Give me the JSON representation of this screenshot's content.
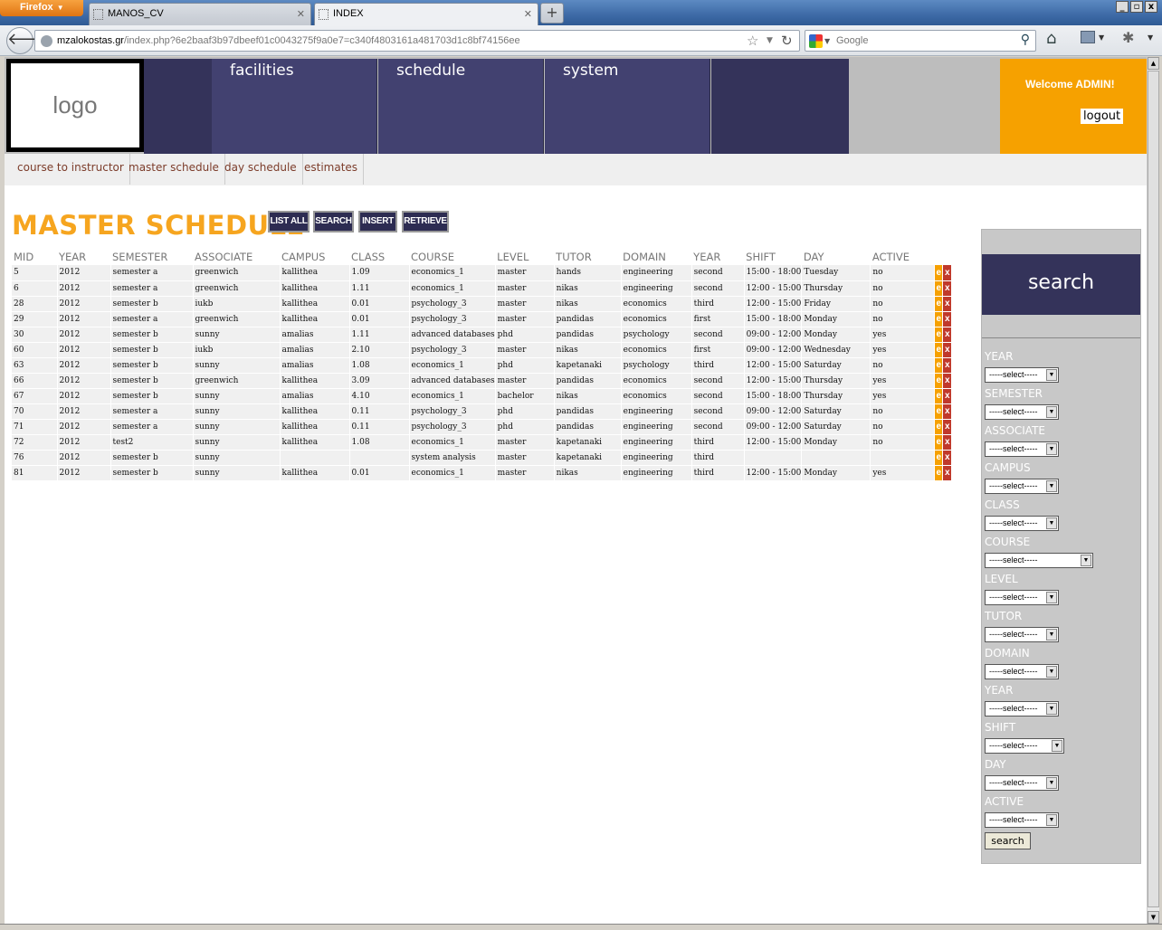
{
  "browser": {
    "menu_label": "Firefox",
    "tabs": [
      {
        "title": "MANOS_CV"
      },
      {
        "title": "INDEX"
      }
    ],
    "url_host": "mzalokostas.gr",
    "url_path": "/index.php?6e2baaf3b97dbeef01c0043275f9a0e7=c340f4803161a481703d1c8bf74156ee",
    "search_placeholder": "Google"
  },
  "header": {
    "logo_text": "logo",
    "menu": [
      "facilities",
      "schedule",
      "system"
    ],
    "welcome": "Welcome ADMIN!",
    "logout": "logout"
  },
  "submenu": [
    "course to instructor",
    "master schedule",
    "day schedule",
    "estimates"
  ],
  "page": {
    "title": "MASTER SCHEDULE",
    "buttons": [
      "LIST ALL",
      "SEARCH",
      "INSERT",
      "RETRIEVE"
    ]
  },
  "table": {
    "columns": [
      "MID",
      "YEAR",
      "SEMESTER",
      "ASSOCIATE",
      "CAMPUS",
      "CLASS",
      "COURSE",
      "LEVEL",
      "TUTOR",
      "DOMAIN",
      "YEAR",
      "SHIFT",
      "DAY",
      "ACTIVE"
    ],
    "edit_label": "e",
    "delete_label": "x",
    "rows": [
      [
        "5",
        "2012",
        "semester a",
        "greenwich",
        "kallithea",
        "1.09",
        "economics_1",
        "master",
        "hands",
        "engineering",
        "second",
        "15:00 - 18:00",
        "Tuesday",
        "no"
      ],
      [
        "6",
        "2012",
        "semester a",
        "greenwich",
        "kallithea",
        "1.11",
        "economics_1",
        "master",
        "nikas",
        "engineering",
        "second",
        "12:00 - 15:00",
        "Thursday",
        "no"
      ],
      [
        "28",
        "2012",
        "semester b",
        "iukb",
        "kallithea",
        "0.01",
        "psychology_3",
        "master",
        "nikas",
        "economics",
        "third",
        "12:00 - 15:00",
        "Friday",
        "no"
      ],
      [
        "29",
        "2012",
        "semester a",
        "greenwich",
        "kallithea",
        "0.01",
        "psychology_3",
        "master",
        "pandidas",
        "economics",
        "first",
        "15:00 - 18:00",
        "Monday",
        "no"
      ],
      [
        "30",
        "2012",
        "semester b",
        "sunny",
        "amalias",
        "1.11",
        "advanced databases",
        "phd",
        "pandidas",
        "psychology",
        "second",
        "09:00 - 12:00",
        "Monday",
        "yes"
      ],
      [
        "60",
        "2012",
        "semester b",
        "iukb",
        "amalias",
        "2.10",
        "psychology_3",
        "master",
        "nikas",
        "economics",
        "first",
        "09:00 - 12:00",
        "Wednesday",
        "yes"
      ],
      [
        "63",
        "2012",
        "semester b",
        "sunny",
        "amalias",
        "1.08",
        "economics_1",
        "phd",
        "kapetanaki",
        "psychology",
        "third",
        "12:00 - 15:00",
        "Saturday",
        "no"
      ],
      [
        "66",
        "2012",
        "semester b",
        "greenwich",
        "kallithea",
        "3.09",
        "advanced databases",
        "master",
        "pandidas",
        "economics",
        "second",
        "12:00 - 15:00",
        "Thursday",
        "yes"
      ],
      [
        "67",
        "2012",
        "semester b",
        "sunny",
        "amalias",
        "4.10",
        "economics_1",
        "bachelor",
        "nikas",
        "economics",
        "second",
        "15:00 - 18:00",
        "Thursday",
        "yes"
      ],
      [
        "70",
        "2012",
        "semester a",
        "sunny",
        "kallithea",
        "0.11",
        "psychology_3",
        "phd",
        "pandidas",
        "engineering",
        "second",
        "09:00 - 12:00",
        "Saturday",
        "no"
      ],
      [
        "71",
        "2012",
        "semester a",
        "sunny",
        "kallithea",
        "0.11",
        "psychology_3",
        "phd",
        "pandidas",
        "engineering",
        "second",
        "09:00 - 12:00",
        "Saturday",
        "no"
      ],
      [
        "72",
        "2012",
        "test2",
        "sunny",
        "kallithea",
        "1.08",
        "economics_1",
        "master",
        "kapetanaki",
        "engineering",
        "third",
        "12:00 - 15:00",
        "Monday",
        "no"
      ],
      [
        "76",
        "2012",
        "semester b",
        "sunny",
        "",
        "",
        "system analysis",
        "master",
        "kapetanaki",
        "engineering",
        "third",
        "",
        "",
        ""
      ],
      [
        "81",
        "2012",
        "semester b",
        "sunny",
        "kallithea",
        "0.01",
        "economics_1",
        "master",
        "nikas",
        "engineering",
        "third",
        "12:00 - 15:00",
        "Monday",
        "yes"
      ]
    ]
  },
  "search_panel": {
    "title": "search",
    "select_placeholder": "-----select-----",
    "filters": [
      "YEAR",
      "SEMESTER",
      "ASSOCIATE",
      "CAMPUS",
      "CLASS",
      "COURSE",
      "LEVEL",
      "TUTOR",
      "DOMAIN",
      "YEAR",
      "SHIFT",
      "DAY",
      "ACTIVE"
    ],
    "button": "search"
  },
  "colors": {
    "nav_dark": "#34335a",
    "nav_menu": "#424170",
    "accent_orange": "#f6a100",
    "title_orange": "#f6a51f",
    "delete_red": "#c0392b"
  }
}
